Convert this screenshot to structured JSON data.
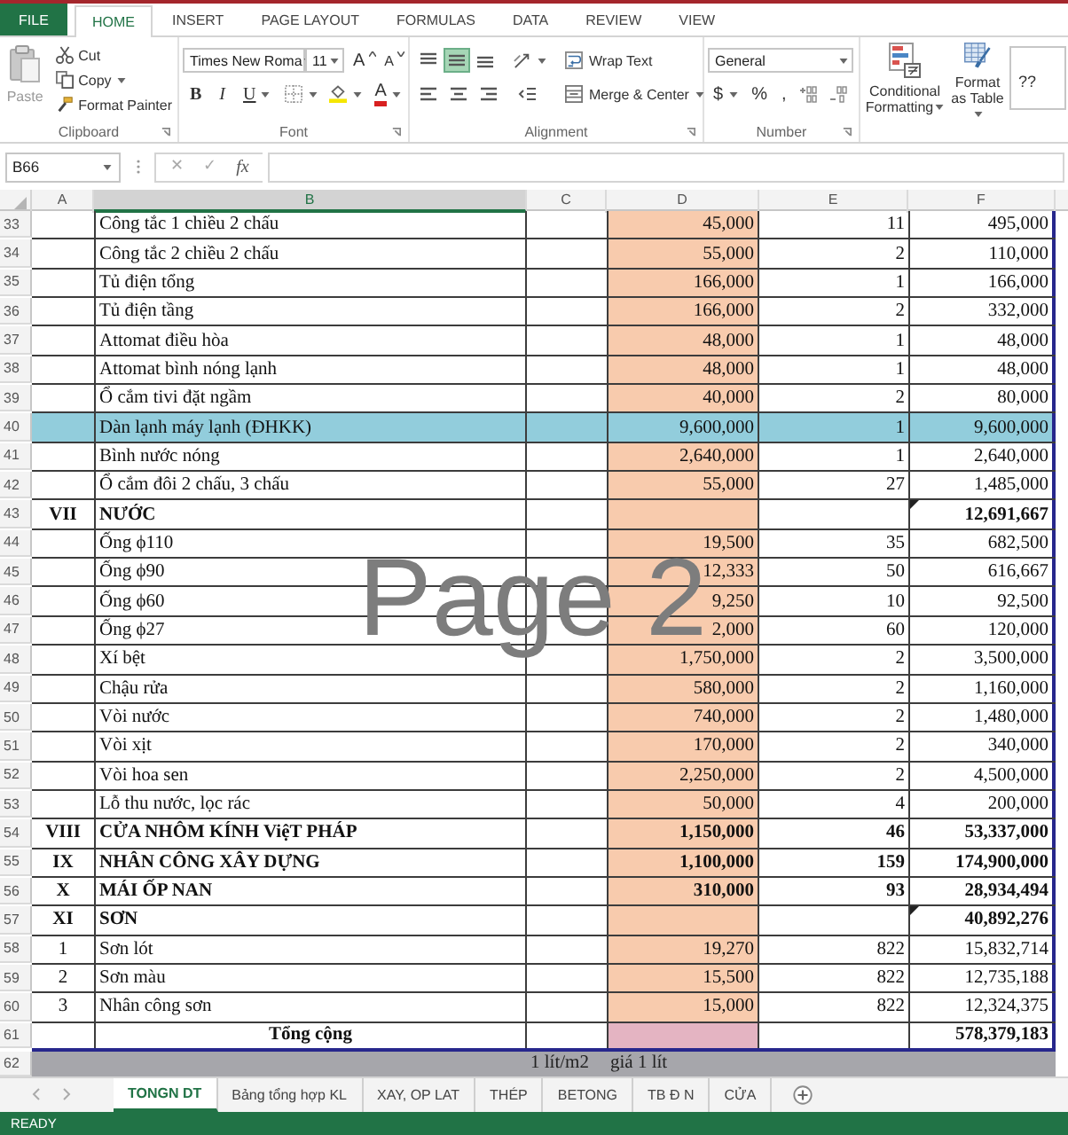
{
  "ribbon": {
    "tabs": [
      {
        "label": "FILE",
        "kind": "file",
        "selected": false
      },
      {
        "label": "HOME",
        "kind": "tab",
        "selected": true
      },
      {
        "label": "INSERT",
        "kind": "tab",
        "selected": false
      },
      {
        "label": "PAGE LAYOUT",
        "kind": "tab",
        "selected": false
      },
      {
        "label": "FORMULAS",
        "kind": "tab",
        "selected": false
      },
      {
        "label": "DATA",
        "kind": "tab",
        "selected": false
      },
      {
        "label": "REVIEW",
        "kind": "tab",
        "selected": false
      },
      {
        "label": "VIEW",
        "kind": "tab",
        "selected": false
      }
    ],
    "clipboard": {
      "paste": "Paste",
      "cut": "Cut",
      "copy": "Copy",
      "format_painter": "Format Painter",
      "label": "Clipboard"
    },
    "font": {
      "font_name": "Times New Roma",
      "font_size": "11",
      "grow": "A",
      "shrink": "A",
      "bold": "B",
      "italic": "I",
      "underline": "U",
      "font_color": "A",
      "label": "Font"
    },
    "alignment": {
      "vertical": [
        {
          "kind": "top",
          "selected": false
        },
        {
          "kind": "middle",
          "selected": true
        },
        {
          "kind": "bottom",
          "selected": false
        }
      ],
      "wrap_text": "Wrap Text",
      "merge": "Merge & Center",
      "label": "Alignment"
    },
    "number": {
      "format": "General",
      "currency": "$",
      "percent": "%",
      "comma": ",",
      "label": "Number"
    },
    "styles": {
      "conditional": "Conditional Formatting",
      "format_table": "Format as Table",
      "cell_styles": "??"
    }
  },
  "formula_bar": {
    "name_box": "B66",
    "cancel": "✕",
    "enter": "✓",
    "function": "fx"
  },
  "sheet": {
    "columns": [
      {
        "label": "A",
        "selected": false
      },
      {
        "label": "B",
        "selected": true
      },
      {
        "label": "C",
        "selected": false
      },
      {
        "label": "D",
        "selected": false
      },
      {
        "label": "E",
        "selected": false
      },
      {
        "label": "F",
        "selected": false
      }
    ],
    "rows": [
      {
        "num": "33",
        "kind": "item",
        "highlighted": false,
        "flagged": false,
        "b": "Công tắc 1 chiều 2 chấu",
        "d": "45,000",
        "e": "11",
        "f": "495,000"
      },
      {
        "num": "34",
        "kind": "item",
        "highlighted": false,
        "flagged": false,
        "b": "Công tắc 2 chiều 2 chấu",
        "d": "55,000",
        "e": "2",
        "f": "110,000"
      },
      {
        "num": "35",
        "kind": "item",
        "highlighted": false,
        "flagged": false,
        "b": "Tủ điện tổng",
        "d": "166,000",
        "e": "1",
        "f": "166,000"
      },
      {
        "num": "36",
        "kind": "item",
        "highlighted": false,
        "flagged": false,
        "b": "Tủ điện tầng",
        "d": "166,000",
        "e": "2",
        "f": "332,000"
      },
      {
        "num": "37",
        "kind": "item",
        "highlighted": false,
        "flagged": false,
        "b": "Attomat điều hòa",
        "d": "48,000",
        "e": "1",
        "f": "48,000"
      },
      {
        "num": "38",
        "kind": "item",
        "highlighted": false,
        "flagged": false,
        "b": "Attomat bình nóng lạnh",
        "d": "48,000",
        "e": "1",
        "f": "48,000"
      },
      {
        "num": "39",
        "kind": "item",
        "highlighted": false,
        "flagged": false,
        "b": "Ổ cắm tivi đặt ngầm",
        "d": "40,000",
        "e": "2",
        "f": "80,000"
      },
      {
        "num": "40",
        "kind": "item",
        "highlighted": true,
        "flagged": false,
        "b": "Dàn lạnh máy lạnh (ĐHKK)",
        "d": "9,600,000",
        "e": "1",
        "f": "9,600,000"
      },
      {
        "num": "41",
        "kind": "item",
        "highlighted": false,
        "flagged": false,
        "b": "Bình nước nóng",
        "d": "2,640,000",
        "e": "1",
        "f": "2,640,000"
      },
      {
        "num": "42",
        "kind": "item",
        "highlighted": false,
        "flagged": false,
        "b": "Ổ cắm đôi 2 chấu, 3 chấu",
        "d": "55,000",
        "e": "27",
        "f": "1,485,000"
      },
      {
        "num": "43",
        "kind": "section",
        "highlighted": false,
        "flagged": true,
        "a": "VII",
        "b": "NƯỚC",
        "f": "12,691,667"
      },
      {
        "num": "44",
        "kind": "item",
        "highlighted": false,
        "flagged": false,
        "b": "Ống ϕ110",
        "d": "19,500",
        "e": "35",
        "f": "682,500"
      },
      {
        "num": "45",
        "kind": "item",
        "highlighted": false,
        "flagged": false,
        "b": "Ống ϕ90",
        "d": "12,333",
        "e": "50",
        "f": "616,667"
      },
      {
        "num": "46",
        "kind": "item",
        "highlighted": false,
        "flagged": false,
        "b": "Ống ϕ60",
        "d": "9,250",
        "e": "10",
        "f": "92,500"
      },
      {
        "num": "47",
        "kind": "item",
        "highlighted": false,
        "flagged": false,
        "b": "Ống ϕ27",
        "d": "2,000",
        "e": "60",
        "f": "120,000"
      },
      {
        "num": "48",
        "kind": "item",
        "highlighted": false,
        "flagged": false,
        "b": "Xí bệt",
        "d": "1,750,000",
        "e": "2",
        "f": "3,500,000"
      },
      {
        "num": "49",
        "kind": "item",
        "highlighted": false,
        "flagged": false,
        "b": "Chậu rửa",
        "d": "580,000",
        "e": "2",
        "f": "1,160,000"
      },
      {
        "num": "50",
        "kind": "item",
        "highlighted": false,
        "flagged": false,
        "b": "Vòi nước",
        "d": "740,000",
        "e": "2",
        "f": "1,480,000"
      },
      {
        "num": "51",
        "kind": "item",
        "highlighted": false,
        "flagged": false,
        "b": "Vòi xịt",
        "d": "170,000",
        "e": "2",
        "f": "340,000"
      },
      {
        "num": "52",
        "kind": "item",
        "highlighted": false,
        "flagged": false,
        "b": "Vòi hoa sen",
        "d": "2,250,000",
        "e": "2",
        "f": "4,500,000"
      },
      {
        "num": "53",
        "kind": "item",
        "highlighted": false,
        "flagged": false,
        "b": "Lỗ thu nước, lọc rác",
        "d": "50,000",
        "e": "4",
        "f": "200,000"
      },
      {
        "num": "54",
        "kind": "section",
        "highlighted": false,
        "flagged": false,
        "a": "VIII",
        "b": "CỬA NHÔM KÍNH ViệT PHÁP",
        "d": "1,150,000",
        "e": "46",
        "f": "53,337,000"
      },
      {
        "num": "55",
        "kind": "section",
        "highlighted": false,
        "flagged": false,
        "a": "IX",
        "b": "NHÂN CÔNG XÂY DỰNG",
        "d": "1,100,000",
        "e": "159",
        "f": "174,900,000"
      },
      {
        "num": "56",
        "kind": "section",
        "highlighted": false,
        "flagged": false,
        "a": "X",
        "b": "MÁI ỐP NAN",
        "d": "310,000",
        "e": "93",
        "f": "28,934,494"
      },
      {
        "num": "57",
        "kind": "section",
        "highlighted": false,
        "flagged": true,
        "a": "XI",
        "b": "SƠN",
        "f": "40,892,276"
      },
      {
        "num": "58",
        "kind": "item",
        "highlighted": false,
        "flagged": false,
        "a": "1",
        "b": "Sơn lót",
        "d": "19,270",
        "e": "822",
        "f": "15,832,714"
      },
      {
        "num": "59",
        "kind": "item",
        "highlighted": false,
        "flagged": false,
        "a": "2",
        "b": "Sơn màu",
        "d": "15,500",
        "e": "822",
        "f": "12,735,188"
      },
      {
        "num": "60",
        "kind": "item",
        "highlighted": false,
        "flagged": false,
        "a": "3",
        "b": "Nhân công sơn",
        "d": "15,000",
        "e": "822",
        "f": "12,324,375"
      },
      {
        "num": "61",
        "kind": "total",
        "highlighted": false,
        "flagged": false,
        "b": "Tổng cộng",
        "f": "578,379,183"
      },
      {
        "num": "62",
        "kind": "outside",
        "highlighted": false,
        "flagged": false,
        "c": "1 lít/m2",
        "d": "giá 1 lít"
      }
    ],
    "page_label": "Page 2"
  },
  "sheet_tabs": [
    {
      "label": "TONGN DT",
      "selected": true
    },
    {
      "label": "Bảng tổng hợp KL",
      "selected": false
    },
    {
      "label": "XAY, OP LAT",
      "selected": false
    },
    {
      "label": "THÉP",
      "selected": false
    },
    {
      "label": "BETONG",
      "selected": false
    },
    {
      "label": "TB Đ N",
      "selected": false
    },
    {
      "label": "CỬA",
      "selected": false
    }
  ],
  "status_bar": {
    "text": "READY"
  }
}
